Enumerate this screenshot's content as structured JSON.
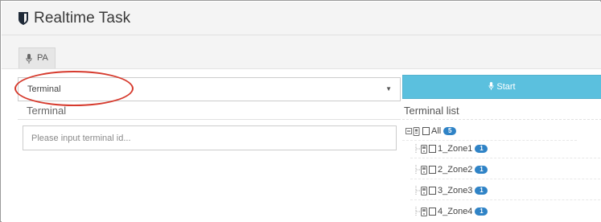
{
  "header": {
    "title": "Realtime Task",
    "logo_icon": "shield-icon"
  },
  "tabs": [
    {
      "label": "PA",
      "icon": "microphone-icon"
    }
  ],
  "controls": {
    "select_value": "Terminal",
    "start_label": "Start",
    "start_color": "#5bc0de",
    "highlight_color": "#d63a2d"
  },
  "left_panel": {
    "label": "Terminal",
    "input_placeholder": "Please input terminal id..."
  },
  "right_panel": {
    "label": "Terminal list",
    "root": {
      "label": "All",
      "badge": "5"
    },
    "items": [
      {
        "label": "1_Zone1",
        "badge": "1"
      },
      {
        "label": "2_Zone2",
        "badge": "1"
      },
      {
        "label": "3_Zone3",
        "badge": "1"
      },
      {
        "label": "4_Zone4",
        "badge": "1"
      }
    ]
  }
}
